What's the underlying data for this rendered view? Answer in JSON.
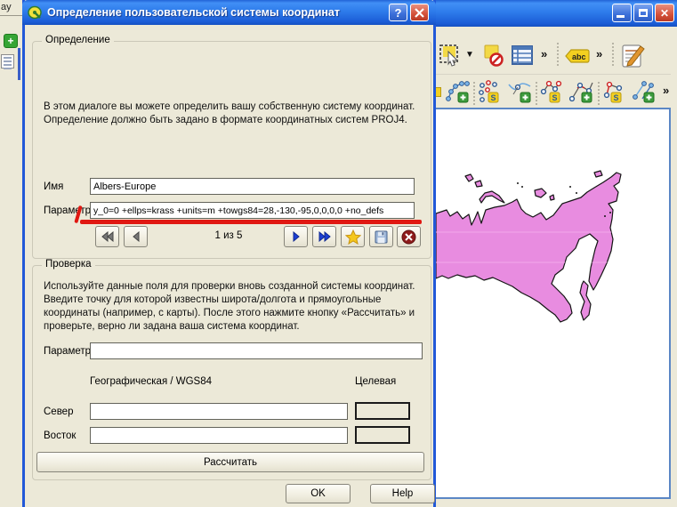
{
  "colors": {
    "map_fill": "#E88CE0",
    "map_outline": "#141414",
    "annotation_red": "#E01812"
  },
  "left_strip": {
    "clipped_text": "ay"
  },
  "main_window": {
    "toolbar1": {
      "overflow_a": "»",
      "abc_label": "abc",
      "overflow_b": "»"
    },
    "toolbar2": {
      "overflow": "»"
    }
  },
  "dialog": {
    "title": "Определение пользовательской системы координат",
    "titlebar_help": "?",
    "define_group": {
      "title": "Определение",
      "desc_lines": [
        "В этом диалоге вы можете определить вашу собственную систему координат.",
        "Определение должно быть задано в формате координатных систем PROJ4."
      ],
      "name_label": "Имя",
      "name_value": "Albers-Europe",
      "params_label": "Параметры",
      "params_value": "y_0=0 +ellps=krass +units=m +towgs84=28,-130,-95,0,0,0,0 +no_defs",
      "record_position": "1 из 5"
    },
    "test_group": {
      "title": "Проверка",
      "desc_lines": [
        "Используйте данные поля для проверки вновь созданной системы координат.",
        "Введите точку для которой известны широта/долгота и прямоугольные",
        "координаты (например, с карты). После этого нажмите кнопку «Рассчитать» и",
        "проверьте, верно ли задана ваша система координат."
      ],
      "params_label": "Параметры",
      "source_header": "Географическая / WGS84",
      "target_header": "Целевая",
      "north_label": "Север",
      "east_label": "Восток",
      "calculate_button": "Рассчитать"
    },
    "ok_button": "OK",
    "help_button": "Help"
  }
}
